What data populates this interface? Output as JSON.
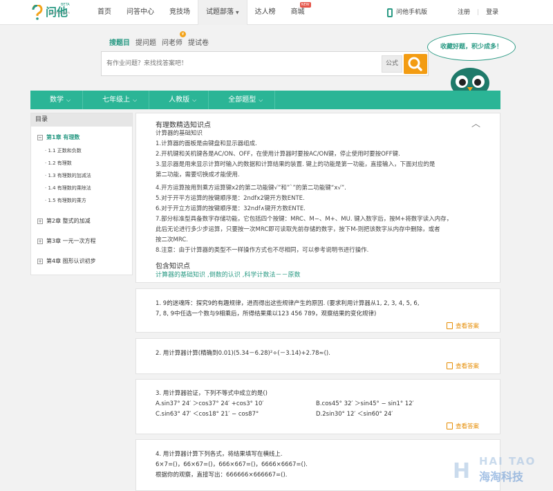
{
  "brand": {
    "name": "问他",
    "sub": "7wenta.com",
    "beta": "BETA"
  },
  "nav": [
    "首页",
    "问答中心",
    "竞技场",
    "试题部落",
    "达人榜",
    "商城"
  ],
  "nav_active": "试题部落",
  "nav_new_badge": "NEW",
  "mobile_label": "问他手机版",
  "auth": {
    "register": "注册",
    "login": "登录",
    "sep": "|"
  },
  "search": {
    "tabs": [
      "搜题目",
      "提问题",
      "问老师",
      "提试卷"
    ],
    "teacher_badge": "¥",
    "placeholder": "有作业问题？来找找答案吧！",
    "formula_label": "公式"
  },
  "mascot_text": "收藏好题，积少成多！",
  "filters": [
    "数学",
    "七年级上",
    "人教版",
    "全部题型"
  ],
  "sidebar": {
    "title": "目录",
    "chapters": [
      {
        "box": "−",
        "label": "第1章 有理数",
        "active": true
      },
      {
        "box": "+",
        "label": "第2章 整式的加减",
        "active": false
      },
      {
        "box": "+",
        "label": "第3章 一元一次方程",
        "active": false
      },
      {
        "box": "+",
        "label": "第4章 图形认识初步",
        "active": false
      }
    ],
    "sections": [
      "· 1.1 正数和负数",
      "· 1.2 有理数",
      "· 1.3 有理数的加减法",
      "· 1.4 有理数的乘除法",
      "· 1.5 有理数的乘方"
    ]
  },
  "knowledge": {
    "title": "有理数精选知识点",
    "collapse": "︿",
    "lines": [
      "计算器的基础知识",
      "1.计算器的面板是由键盘和显示器组成.",
      "2.开机键和关机键各是AC/ON、OFF，在使用计算器时要按AC/ON键，停止使用时要按OFF键.",
      "3.显示器是用来显示计算时输入的数据和计算结果的装置. 键上的功能是第一功能，直接输入，下面对应的是",
      "第二功能，需要切换成才能使用.",
      "4.开方运算按用到乘方运算键x2的第二功能键√”和”`”的第二功能键“x√”.",
      "5.对于开平方运算的按键顺序是：2ndfx2键开方数ENTE.",
      "6.对于开立方运算的按键顺序是：32ndf∧键开方数ENTE.",
      "7.部分标准型具备数字存储功能，它包括四个按键：MRC、M−、M+、MU. 键入数字后，按M+将数字读入内存，",
      "此后无论进行多少步运算，只要按一次MRC即可读取先前存储的数字，按下M-则把该数字从内存中删除，或者",
      "按二次MRC.",
      "8.注意：由于计算器的类型不一样操作方式也不尽相同，可以参考说明书进行操作."
    ],
    "contains_title": "包含知识点",
    "contains": "计算器的基础知识 ,倒数的认识 ,科学计数法－－原数"
  },
  "answer_label": "查看答案",
  "questions": [
    {
      "lines": [
        "1. 9的迷魂阵：探究9的有趣规律，进而得出这些规律产生的原因. (要求利用计算器从1, 2, 3, 4, 5, 6,",
        "7, 8, 9中任选一个数与9相乘后，所得结果乘以123 456 789，观察结果的变化规律)"
      ]
    },
    {
      "lines": [
        "2. 用计算器计算(精确到0.01)(5.34－6.28)²÷(－3.14)+2.78≈()."
      ]
    },
    {
      "lines": [
        "3. 用计算器验证，下列不等式中成立的是()",
        "A.sin37° 24′ ＞cos37° 24′ +cos3° 10′",
        "B.cos45° 32′ ＞sin45° − sin1° 12′",
        "C.sin63° 47′ ＜cos18° 21′ − cos87°",
        "D.2sin30° 12′ ＜sin60° 24′"
      ]
    },
    {
      "lines": [
        "4. 用计算器计算下列各式，将结果填写在横线上.",
        "6×7=()，66×67=()，666×667=()，6666×6667=().",
        "根据你的观察，直接写出：666666×666667=()."
      ]
    }
  ],
  "watermark": {
    "latin": "HAI TAO",
    "cn": "海淘科技",
    "letter": "H"
  }
}
